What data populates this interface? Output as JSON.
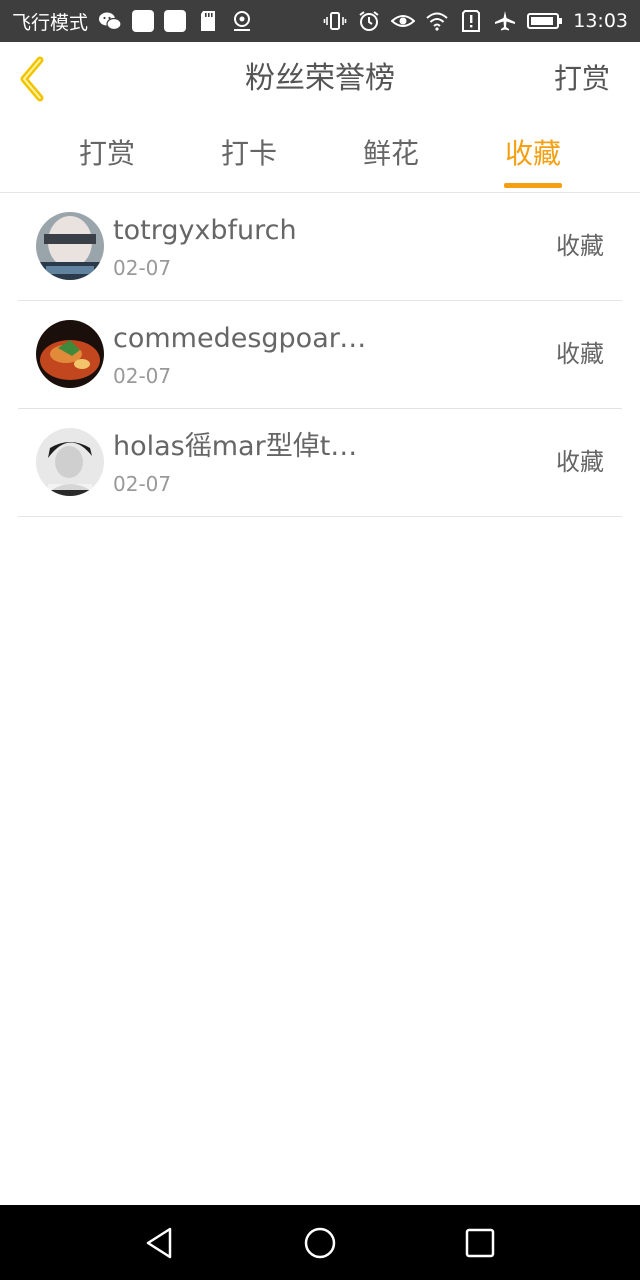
{
  "status_bar": {
    "airplane_mode_text": "飞行模式",
    "time": "13:03",
    "left_icons": [
      "wechat-icon",
      "app-square-icon",
      "app-square-icon",
      "sd-card-icon",
      "location-icon"
    ],
    "right_icons": [
      "vibrate-icon",
      "alarm-icon",
      "eye-icon",
      "wifi-icon",
      "alert-icon",
      "airplane-icon",
      "battery-icon"
    ]
  },
  "header": {
    "title": "粉丝荣誉榜",
    "action_label": "打赏",
    "back_icon": "chevron-left-icon"
  },
  "tabs": [
    {
      "label": "打赏",
      "active": false
    },
    {
      "label": "打卡",
      "active": false
    },
    {
      "label": "鲜花",
      "active": false
    },
    {
      "label": "收藏",
      "active": true
    }
  ],
  "items": [
    {
      "name": "totrgyxbfurch",
      "date": "02-07",
      "action": "收藏",
      "avatar": "user-avatar-1"
    },
    {
      "name": "commedesgpoarc…",
      "date": "02-07",
      "action": "收藏",
      "avatar": "user-avatar-2"
    },
    {
      "name": "holas徭mar型倬t…",
      "date": "02-07",
      "action": "收藏",
      "avatar": "user-avatar-3"
    }
  ],
  "colors": {
    "accent": "#f4a012",
    "back_icon": "#f2c400",
    "status_bar": "#3e3e3e",
    "nav_bar": "#000000",
    "text_primary": "#666666",
    "text_secondary": "#999999"
  },
  "nav_bar": {
    "icons": [
      "back-triangle-icon",
      "home-circle-icon",
      "recents-square-icon"
    ]
  }
}
